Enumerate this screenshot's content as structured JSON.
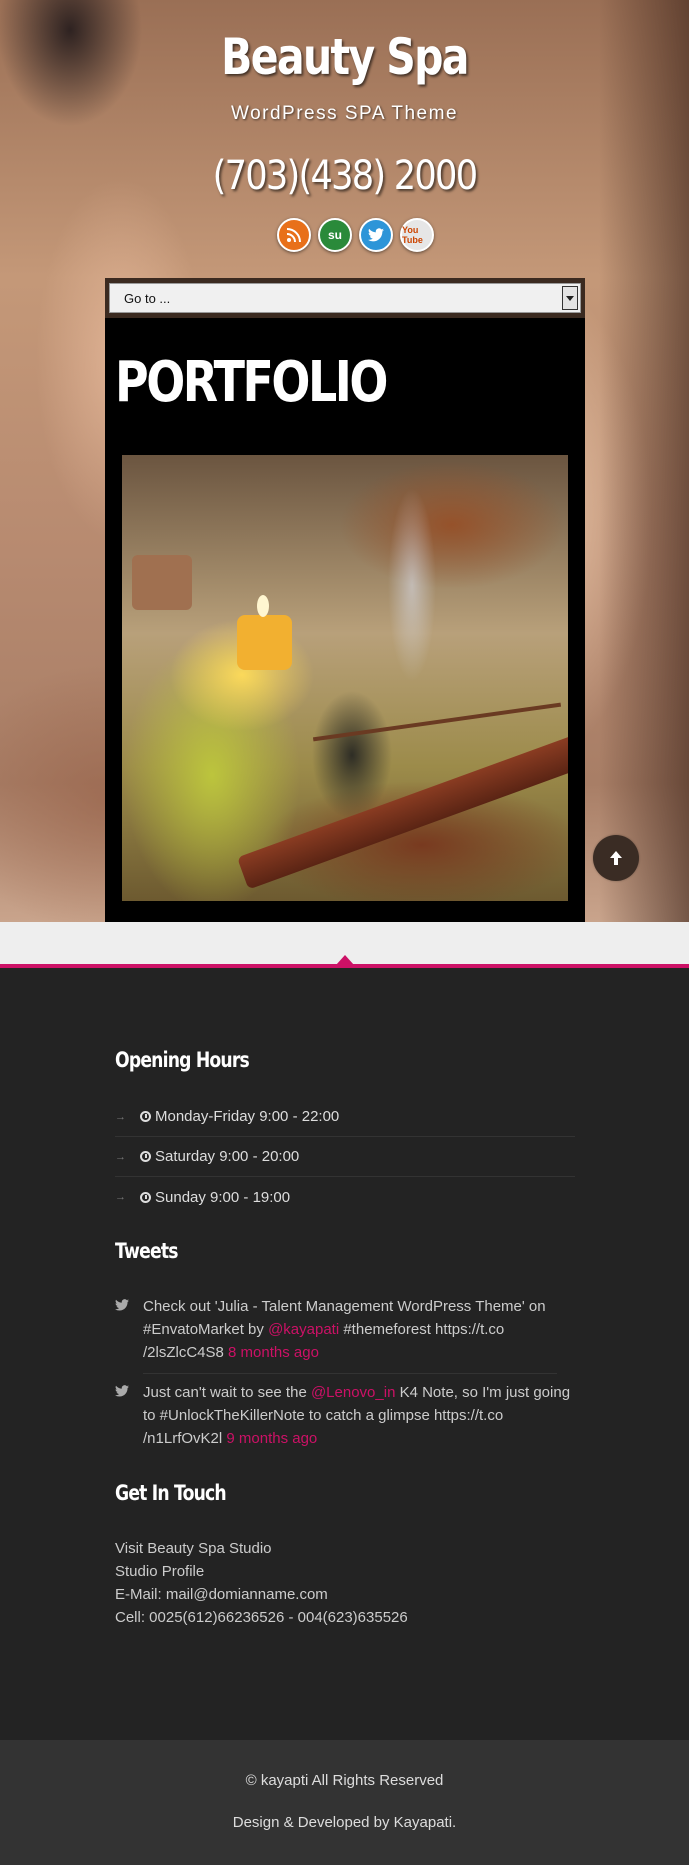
{
  "header": {
    "site_title": "Beauty Spa",
    "tagline": "WordPress SPA Theme",
    "phone": "(703)(438) 2000",
    "social_icons": [
      "rss-icon",
      "stumbleupon-icon",
      "twitter-icon",
      "youtube-icon"
    ],
    "youtube_label": "You Tube",
    "stumbleupon_label": "su"
  },
  "nav": {
    "select_value": "Go to ..."
  },
  "main": {
    "page_title": "PORTFOLIO"
  },
  "opening_hours": {
    "title": "Opening Hours",
    "items": [
      "Monday-Friday 9:00 - 22:00",
      "Saturday 9:00 - 20:00",
      "Sunday 9:00 - 19:00"
    ]
  },
  "tweets": {
    "title": "Tweets",
    "items": [
      {
        "before": "Check out 'Julia - Talent Management WordPress Theme' on #EnvatoMarket by ",
        "mention": "@kayapati",
        "after": " #themeforest https://t.co /2lsZlcC4S8 ",
        "time": "8 months ago"
      },
      {
        "before": "Just can't wait to see the ",
        "mention": "@Lenovo_in",
        "after": " K4 Note, so I'm just going to #UnlockTheKillerNote to catch a glimpse https://t.co /n1LrfOvK2l ",
        "time": "9 months ago"
      }
    ]
  },
  "contact": {
    "title": "Get In Touch",
    "lines": [
      "Visit Beauty Spa Studio",
      "Studio Profile",
      "E-Mail: mail@domianname.com",
      "Cell: 0025(612)66236526 - 004(623)635526"
    ]
  },
  "footer": {
    "copyright": "© kayapti All Rights Reserved",
    "credit": "Design & Developed by Kayapati."
  },
  "colors": {
    "accent": "#cc1166",
    "footer_bg": "#232323",
    "footer_bottom_bg": "#333333"
  }
}
